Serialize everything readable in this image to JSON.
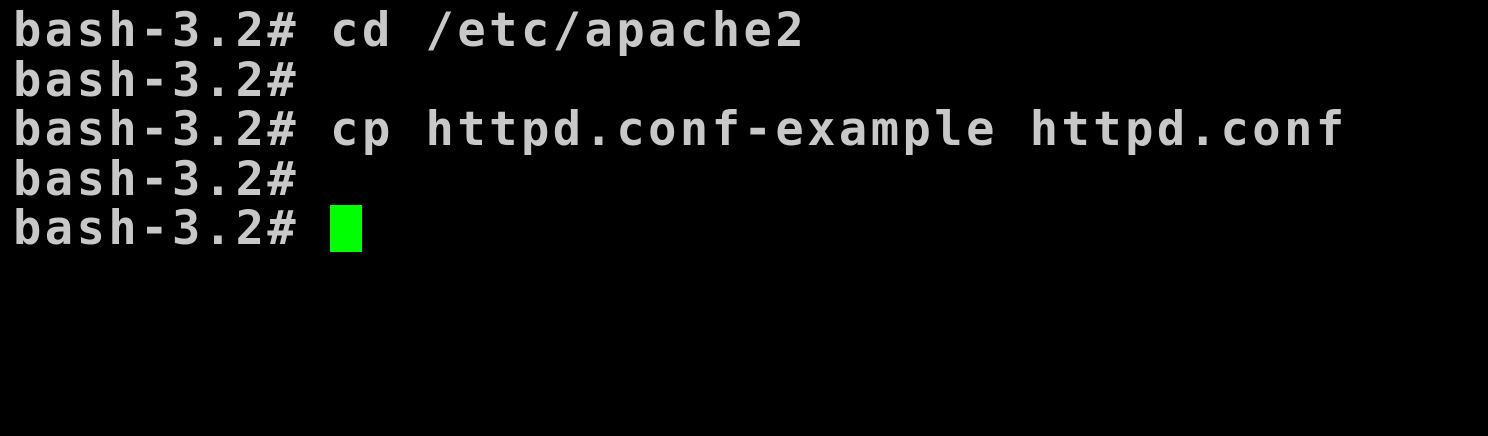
{
  "terminal": {
    "lines": [
      {
        "prompt": "bash-3.2#",
        "command": "cd /etc/apache2"
      },
      {
        "prompt": "bash-3.2#",
        "command": ""
      },
      {
        "prompt": "bash-3.2#",
        "command": "cp httpd.conf-example httpd.conf"
      },
      {
        "prompt": "bash-3.2#",
        "command": ""
      },
      {
        "prompt": "bash-3.2#",
        "command": ""
      }
    ],
    "colors": {
      "background": "#000000",
      "text": "#c8c8c8",
      "cursor": "#00ff00"
    }
  }
}
